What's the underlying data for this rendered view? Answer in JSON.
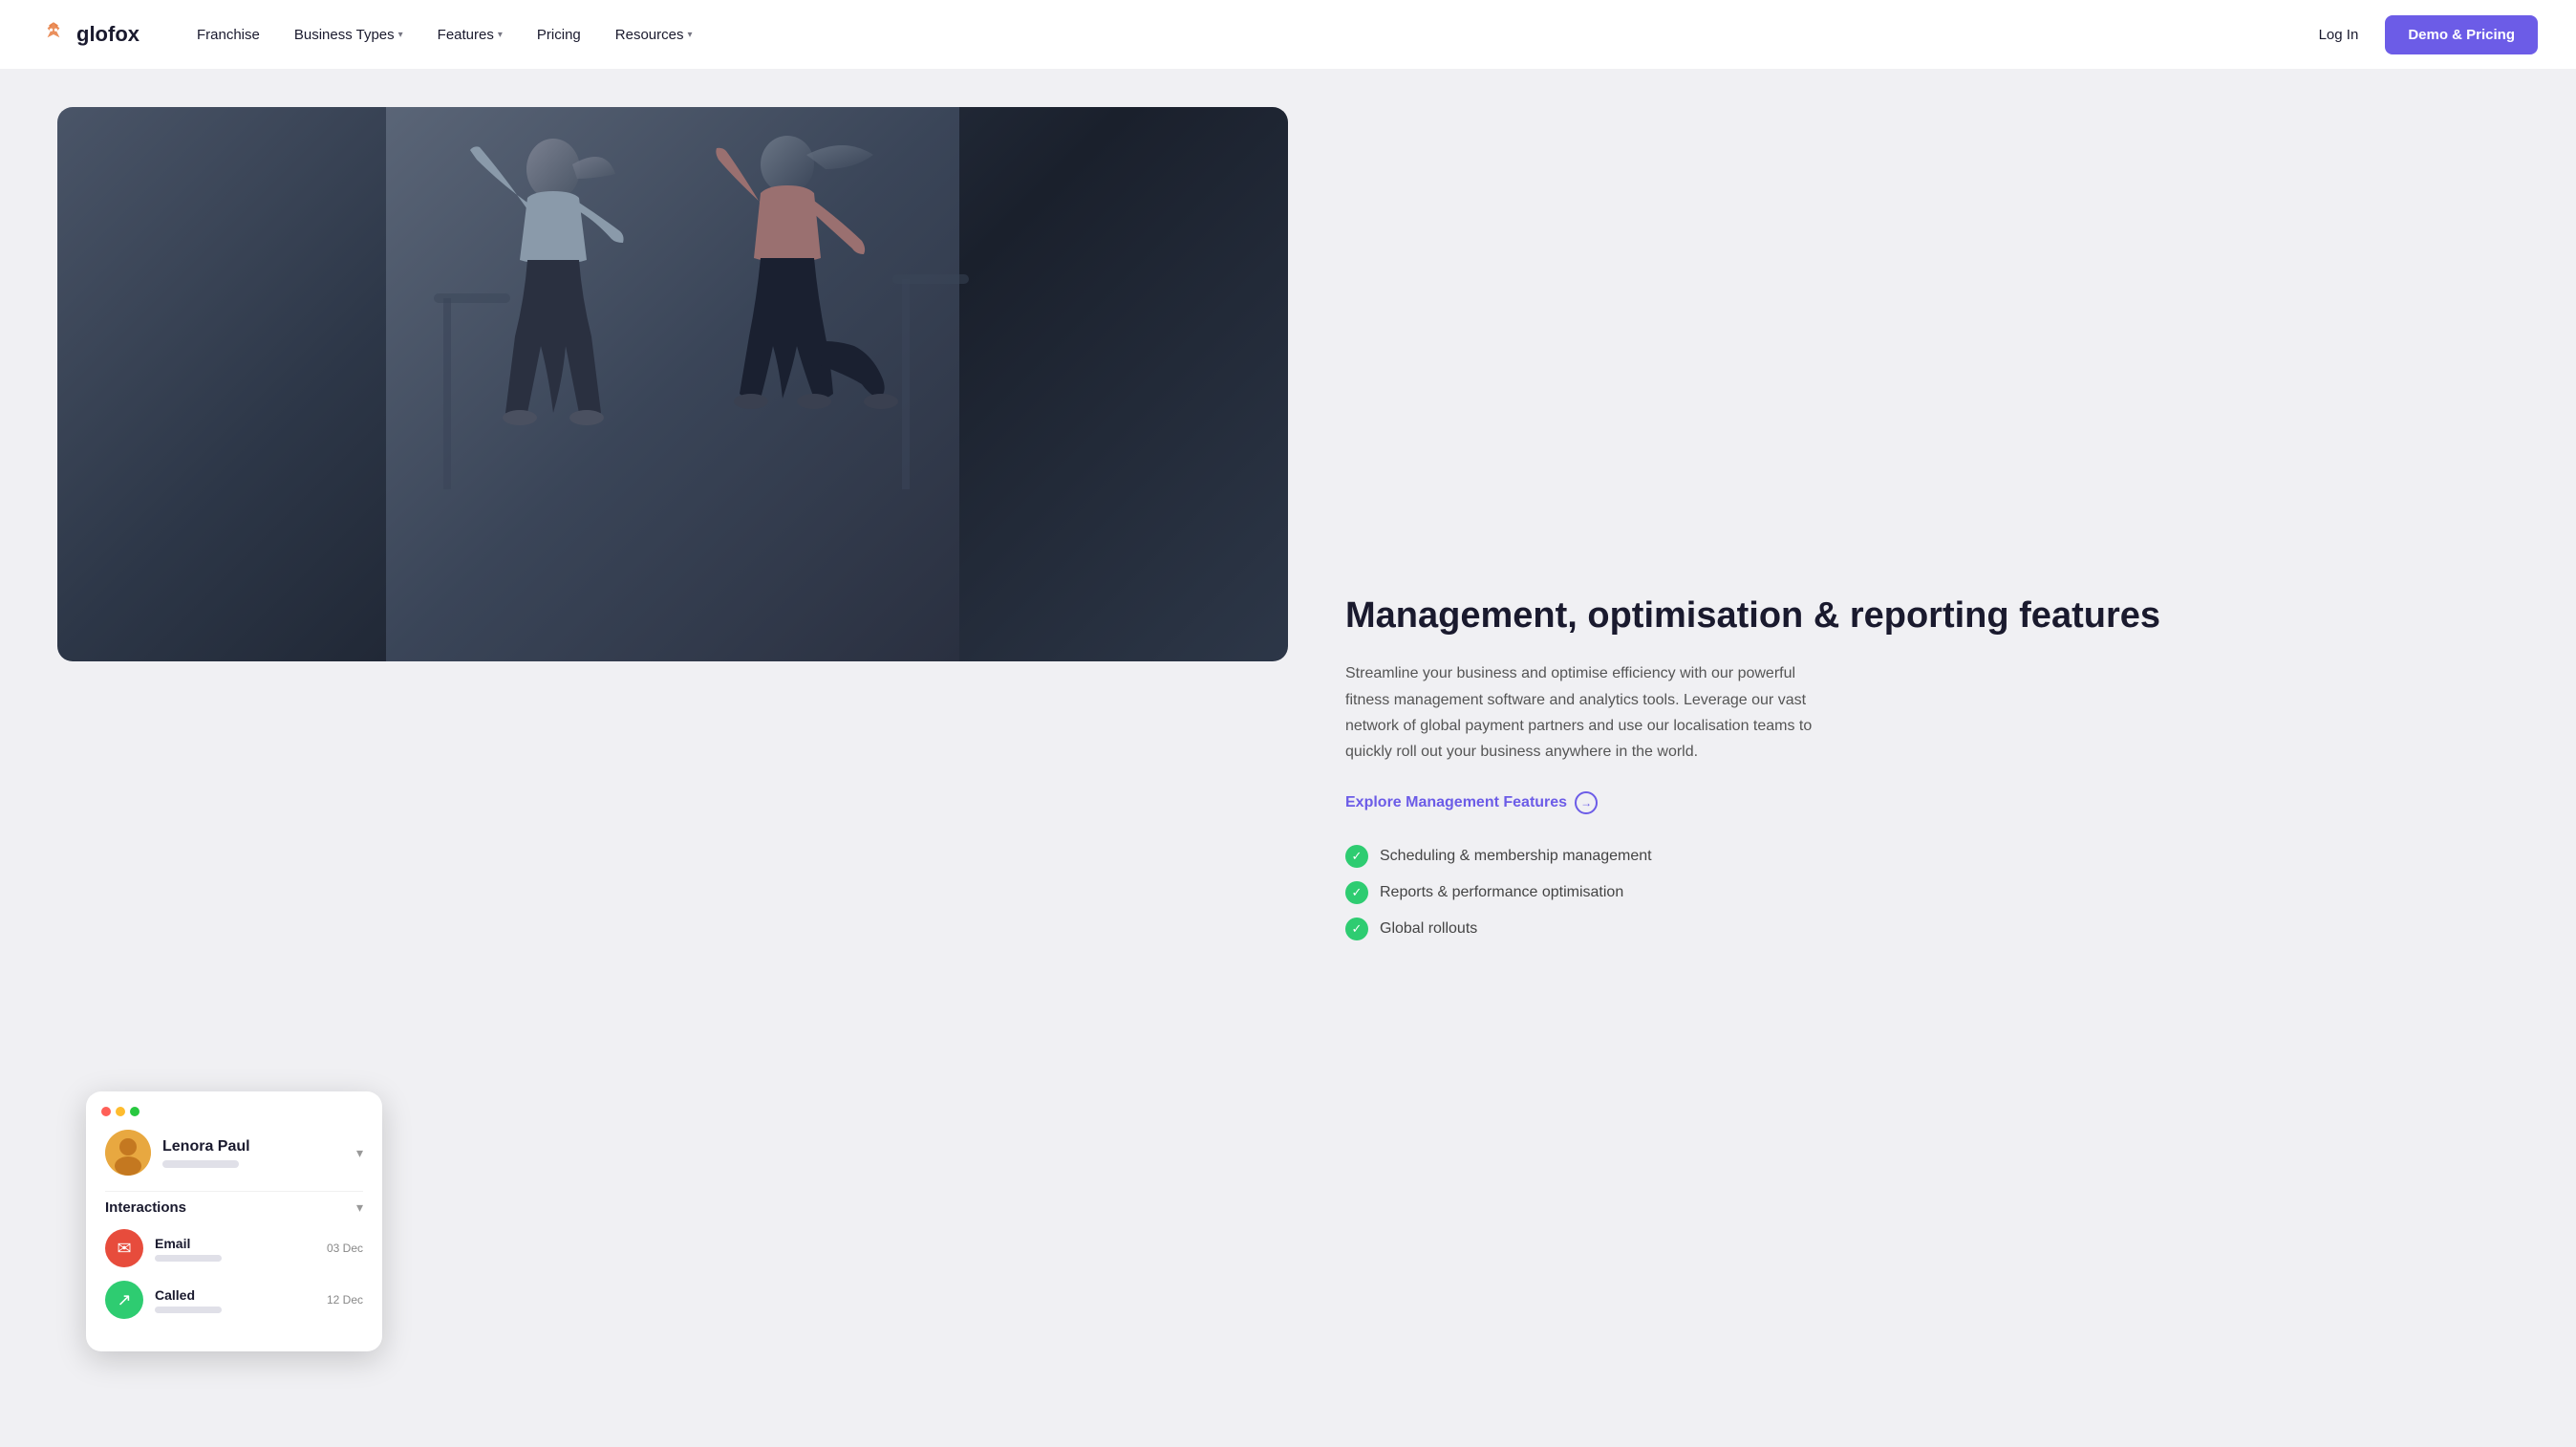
{
  "nav": {
    "logo_text": "glofox",
    "links": [
      {
        "label": "Franchise",
        "has_dropdown": false
      },
      {
        "label": "Business Types",
        "has_dropdown": true
      },
      {
        "label": "Features",
        "has_dropdown": true
      },
      {
        "label": "Pricing",
        "has_dropdown": false
      },
      {
        "label": "Resources",
        "has_dropdown": true
      }
    ],
    "login_label": "Log In",
    "cta_label": "Demo & Pricing"
  },
  "ui_card": {
    "user_name": "Lenora Paul",
    "interactions_label": "Interactions",
    "interactions": [
      {
        "type": "Email",
        "date": "03 Dec"
      },
      {
        "type": "Called",
        "date": "12 Dec"
      }
    ]
  },
  "hero": {
    "title": "Management, optimisation & reporting features",
    "description": "Streamline your business and optimise efficiency with our powerful fitness management software and analytics tools. Leverage our vast network of global payment partners and use our localisation teams to quickly roll out your business anywhere in the world.",
    "explore_label": "Explore Management Features",
    "features": [
      "Scheduling & membership management",
      "Reports & performance optimisation",
      "Global rollouts"
    ]
  },
  "colors": {
    "accent": "#6c5ce7",
    "green": "#2ecc71",
    "red": "#e74c3c"
  }
}
